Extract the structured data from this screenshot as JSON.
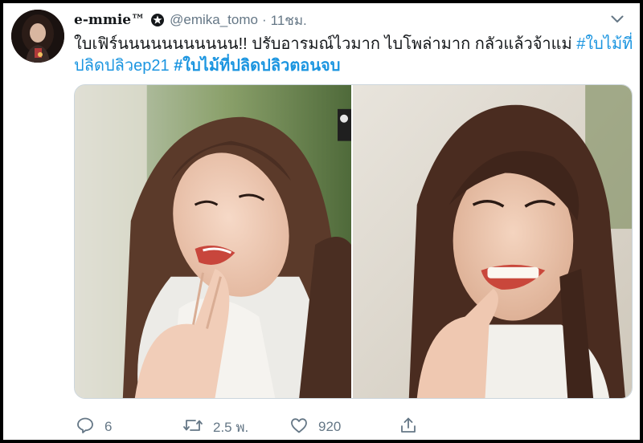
{
  "tweet": {
    "display_name": "e-mmie™",
    "handle": "@emika_tomo",
    "separator": "·",
    "time": "11ชม.",
    "text_line1_plain": "ใบเฟิร์นนนนนนนนนนน!! ปรับอารมณ์ไวมาก ไบโพล่ามาก กลัวแล้วจ้าแม่ ",
    "hashtag1_part1": "#ใบไม้ที่",
    "hashtag1_part2": "ปลิดปลิวep21",
    "hashtag2": "#ใบไม้ที่ปลิดปลิวตอนจบ",
    "hashtag_color": "#1b95e0"
  },
  "actions": {
    "reply_count": "6",
    "retweet_count": "2.5 พ.",
    "like_count": "920"
  },
  "icons": {
    "verified": "verified-badge-icon",
    "caret": "chevron-down-icon",
    "reply": "reply-icon",
    "retweet": "retweet-icon",
    "like": "heart-icon",
    "share": "share-icon"
  },
  "colors": {
    "text": "#14171a",
    "secondary": "#657786",
    "border": "#ccd6dd"
  }
}
